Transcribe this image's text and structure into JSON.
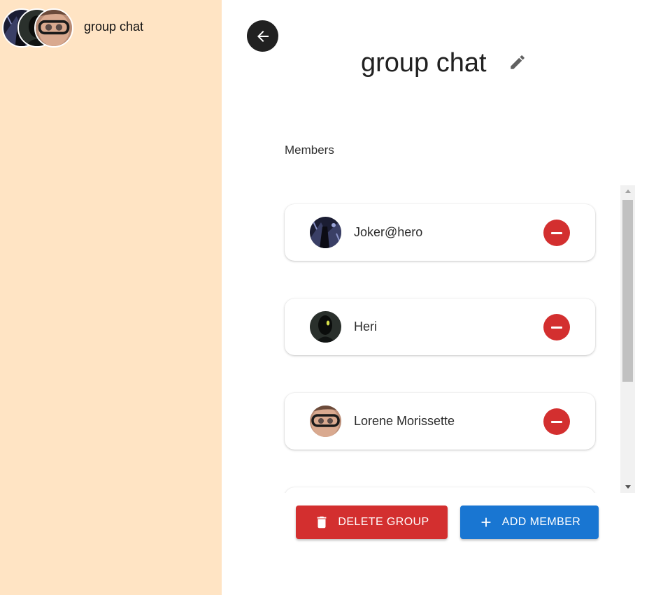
{
  "sidebar": {
    "chat": {
      "name": "group chat"
    }
  },
  "header": {
    "title": "group chat"
  },
  "members_section": {
    "label": "Members",
    "members": [
      {
        "name": "Joker@hero"
      },
      {
        "name": "Heri"
      },
      {
        "name": "Lorene Morissette"
      },
      {
        "name": ""
      }
    ]
  },
  "actions": {
    "delete_label": "DELETE GROUP",
    "add_label": "ADD MEMBER"
  },
  "icons": {
    "back": "arrow-left-icon",
    "edit": "pencil-icon",
    "remove": "minus-circle-icon",
    "delete": "trash-icon",
    "add": "plus-icon"
  },
  "colors": {
    "sidebar_bg": "#ffe4c4",
    "danger": "#d32f2f",
    "primary": "#1976d2",
    "back_button": "#212121"
  }
}
